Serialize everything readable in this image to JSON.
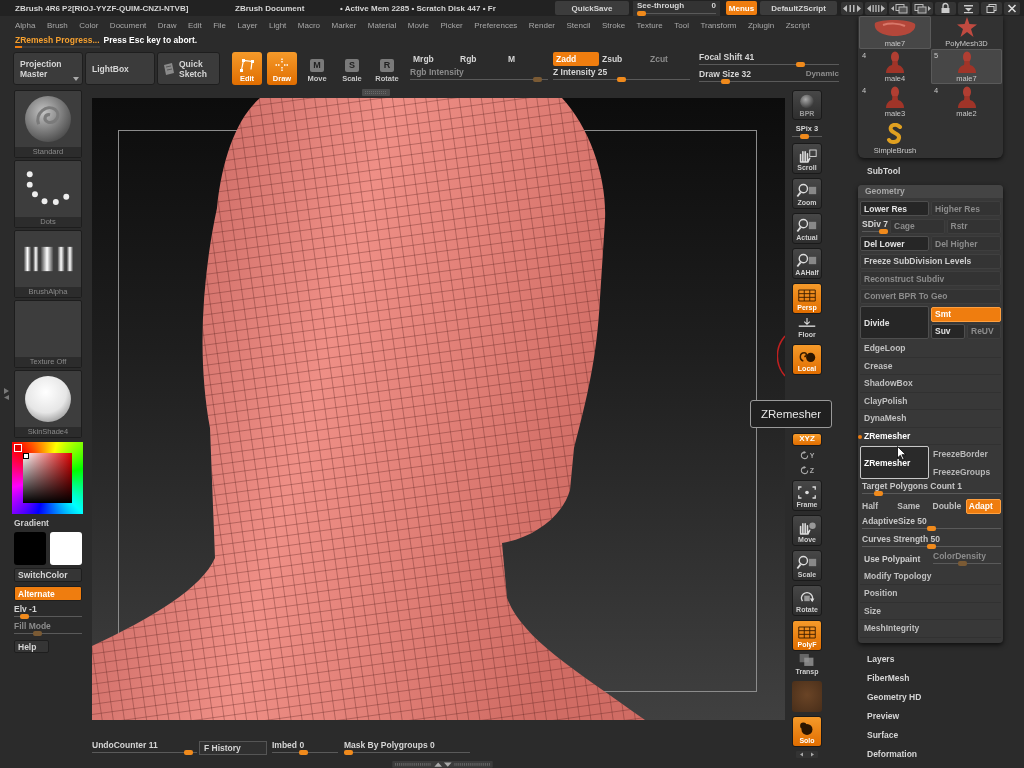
{
  "title_bar": {
    "app_title": "ZBrush 4R6 P2[RIOJ-YYZF-QUIM-CNZI-NTVB]",
    "document": "ZBrush Document",
    "stats": "• Active Mem 2285 • Scratch Disk 447 • Fr",
    "quick_save": "QuickSave",
    "see_through": {
      "label": "See-through",
      "value": "0",
      "level": 0
    },
    "menus": {
      "label": "Menus",
      "on": true
    },
    "script": "DefaultZScript"
  },
  "menu_bar": [
    "Alpha",
    "Brush",
    "Color",
    "Document",
    "Draw",
    "Edit",
    "File",
    "Layer",
    "Light",
    "Macro",
    "Marker",
    "Material",
    "Movie",
    "Picker",
    "Preferences",
    "Render",
    "Stencil",
    "Stroke",
    "Texture",
    "Tool",
    "Transform",
    "Zplugin",
    "Zscript"
  ],
  "progress": {
    "title": "ZRemesh Progress...",
    "message": "Press Esc key to abort.",
    "level": 0.08
  },
  "shelf": {
    "buttons": [
      {
        "label": "Projection Master",
        "dropdown": true
      },
      {
        "label": "LightBox",
        "dropdown": false
      }
    ],
    "quick_sketch": "Quick Sketch",
    "tools": [
      {
        "kind": "edit",
        "label": "Edit",
        "selected": true
      },
      {
        "kind": "draw",
        "label": "Draw",
        "selected": true
      },
      {
        "kind": "lettered",
        "glyph": "M",
        "label": "Move",
        "selected": false
      },
      {
        "kind": "lettered",
        "glyph": "S",
        "label": "Scale",
        "selected": false
      },
      {
        "kind": "lettered",
        "glyph": "R",
        "label": "Rotate",
        "selected": false
      }
    ],
    "color_modes": [
      {
        "label": "Mrgb",
        "selected": false
      },
      {
        "label": "Rgb",
        "selected": false
      },
      {
        "label": "M",
        "selected": false
      }
    ],
    "rgb_intensity": {
      "label": "Rgb Intensity",
      "level": 0.95,
      "disabled": true
    },
    "z_modes": [
      {
        "label": "Zadd",
        "selected": true,
        "disabled": false
      },
      {
        "label": "Zsub",
        "selected": false,
        "disabled": false
      },
      {
        "label": "Zcut",
        "selected": false,
        "disabled": true
      }
    ],
    "z_intensity": {
      "label": "Z Intensity 25",
      "level": 0.5
    },
    "focal_shift": {
      "label": "Focal Shift 41",
      "level": 0.74
    },
    "draw_size": {
      "label": "Draw Size 32",
      "level": 0.17
    },
    "dynamic": {
      "label": "Dynamic",
      "disabled": true
    }
  },
  "left_panel": {
    "thumbnails": [
      {
        "kind": "brush",
        "label": "Standard"
      },
      {
        "kind": "stroke",
        "label": "Dots"
      },
      {
        "kind": "alpha",
        "label": "BrushAlpha"
      },
      {
        "kind": "texture",
        "label": "Texture Off"
      },
      {
        "kind": "material",
        "label": "SkinShade4"
      }
    ],
    "gradient": "Gradient",
    "swatches": [
      {
        "color": "#000000"
      },
      {
        "color": "#ffffff"
      }
    ],
    "switch_color": "SwitchColor",
    "alternate": {
      "label": "Alternate",
      "on": true
    },
    "elevation": {
      "label": "Elv -1",
      "level": 0.1,
      "disabled": false
    },
    "fill_mode": {
      "label": "Fill Mode",
      "level": 0.32,
      "disabled": true
    },
    "help": "Help"
  },
  "tooltip": "ZRemesher",
  "view_toolbar": [
    {
      "kind": "bpr",
      "label": "BPR",
      "selected": false
    },
    {
      "kind": "slider",
      "label": "SPix 3",
      "level": 0.38
    },
    {
      "kind": "scroll",
      "label": "Scroll",
      "selected": false
    },
    {
      "kind": "zoom",
      "label": "Zoom",
      "selected": false
    },
    {
      "kind": "actual",
      "label": "Actual",
      "selected": false
    },
    {
      "kind": "aahalf",
      "label": "AAHalf",
      "selected": false
    },
    {
      "kind": "persp",
      "label": "Persp",
      "selected": true
    },
    {
      "kind": "floor",
      "label": "Floor",
      "selected": false
    },
    {
      "kind": "local",
      "label": "Local",
      "selected": true
    },
    {
      "kind": "xyz",
      "label": "XYZ",
      "selected": true
    },
    {
      "kind": "axis",
      "label": "Y",
      "selected": false
    },
    {
      "kind": "axis",
      "label": "Z",
      "selected": false
    },
    {
      "kind": "frame",
      "label": "Frame",
      "selected": false
    },
    {
      "kind": "move",
      "label": "Move",
      "selected": false
    },
    {
      "kind": "scale",
      "label": "Scale",
      "selected": false
    },
    {
      "kind": "rotate",
      "label": "Rotate",
      "selected": false
    },
    {
      "kind": "polyf",
      "label": "PolyF",
      "selected": true
    },
    {
      "kind": "transp",
      "label": "Transp",
      "selected": false
    },
    {
      "kind": "swatch"
    },
    {
      "kind": "solo",
      "label": "Solo",
      "selected": true
    },
    {
      "kind": "arrows"
    }
  ],
  "bottom_bar": {
    "undo_counter": {
      "label": "UndoCounter 11",
      "level": 0.96
    },
    "history": "F History",
    "imbed": {
      "label": "Imbed 0",
      "level": 0.47
    },
    "mask_by_polygroups": {
      "label": "Mask By Polygroups 0",
      "level": 0
    }
  },
  "subtools": [
    {
      "kind": "blob",
      "label": "male7",
      "selected": true
    },
    {
      "kind": "star",
      "label": "PolyMesh3D",
      "selected": false
    },
    {
      "kind": "mesh",
      "count": "4",
      "label": "male4",
      "selected": false
    },
    {
      "kind": "mesh",
      "count": "5",
      "label": "male7",
      "selected": true
    },
    {
      "kind": "mesh",
      "count": "4",
      "label": "male3",
      "selected": false
    },
    {
      "kind": "mesh",
      "count": "4",
      "label": "male2",
      "selected": false
    },
    {
      "kind": "brush",
      "label": "SimpleBrush",
      "selected": false
    }
  ],
  "tool_palette": {
    "subtool": "SubTool",
    "geometry": {
      "title": "Geometry",
      "rows": [
        {
          "kind": "pair",
          "items": [
            {
              "label": "Lower Res",
              "disabled": false
            },
            {
              "label": "Higher Res",
              "disabled": true
            }
          ]
        },
        {
          "kind": "sdiv",
          "slider": {
            "label": "SDiv 7",
            "level": 1
          },
          "items": [
            {
              "label": "Cage",
              "disabled": true
            },
            {
              "label": "Rstr",
              "disabled": true
            }
          ]
        },
        {
          "kind": "pair",
          "items": [
            {
              "label": "Del Lower",
              "disabled": false
            },
            {
              "label": "Del Higher",
              "disabled": true
            }
          ]
        },
        {
          "kind": "wide",
          "label": "Freeze SubDivision Levels",
          "disabled": false
        },
        {
          "kind": "wide",
          "label": "Reconstruct Subdiv",
          "disabled": true
        },
        {
          "kind": "wide",
          "label": "Convert BPR To Geo",
          "disabled": true
        },
        {
          "kind": "divide",
          "label": "Divide",
          "options": [
            {
              "label": "Smt",
              "selected": true,
              "disabled": false
            },
            {
              "label": "Suv",
              "selected": false,
              "disabled": false
            },
            {
              "label": "ReUV",
              "selected": false,
              "disabled": true
            }
          ]
        },
        {
          "kind": "section",
          "label": "EdgeLoop",
          "expanded": false
        },
        {
          "kind": "section",
          "label": "Crease",
          "expanded": false
        },
        {
          "kind": "section",
          "label": "ShadowBox",
          "expanded": false
        },
        {
          "kind": "section",
          "label": "ClayPolish",
          "expanded": false
        },
        {
          "kind": "section",
          "label": "DynaMesh",
          "expanded": false
        },
        {
          "kind": "section",
          "label": "ZRemesher",
          "expanded": true
        },
        {
          "kind": "zremesher",
          "label": "ZRemesher",
          "options": [
            {
              "label": "FreezeBorder",
              "selected": false
            },
            {
              "label": "FreezeGroups",
              "selected": false
            }
          ]
        },
        {
          "kind": "slider",
          "label": "Target Polygons Count 1",
          "level": 0.09
        },
        {
          "kind": "choice",
          "options": [
            {
              "label": "Half",
              "selected": false
            },
            {
              "label": "Same",
              "selected": false
            },
            {
              "label": "Double",
              "selected": false
            },
            {
              "label": "Adapt",
              "selected": true
            }
          ]
        },
        {
          "kind": "slider",
          "label": "AdaptiveSize 50",
          "level": 0.5
        },
        {
          "kind": "slider",
          "label": "Curves Strength 50",
          "level": 0.5
        },
        {
          "kind": "polypaint",
          "label": "Use Polypaint",
          "slider": {
            "label": "ColorDensity",
            "level": 0.43,
            "disabled": true
          }
        },
        {
          "kind": "section",
          "label": "Modify Topology",
          "expanded": false
        },
        {
          "kind": "section",
          "label": "Position",
          "expanded": false
        },
        {
          "kind": "section",
          "label": "Size",
          "expanded": false
        },
        {
          "kind": "section",
          "label": "MeshIntegrity",
          "expanded": false
        }
      ]
    },
    "sections": [
      "Layers",
      "FiberMesh",
      "Geometry HD",
      "Preview",
      "Surface",
      "Deformation"
    ]
  }
}
